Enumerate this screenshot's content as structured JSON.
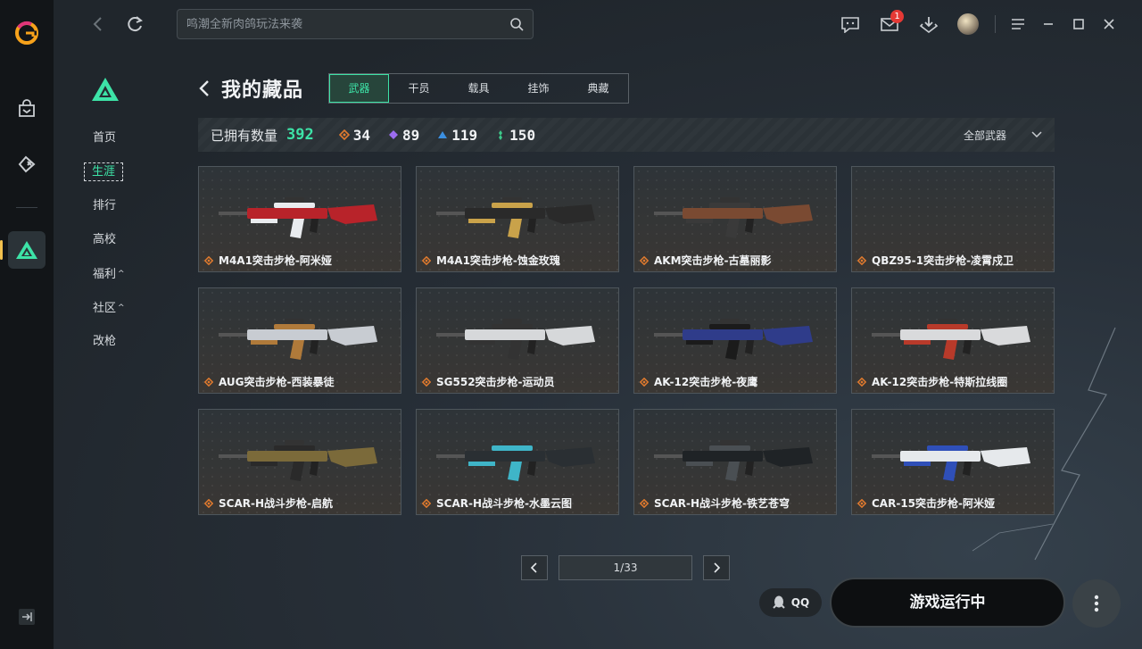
{
  "topbar": {
    "search_placeholder": "鸣潮全新肉鸽玩法来袭",
    "message_badge": "1"
  },
  "subnav": {
    "items": [
      {
        "label": "首页",
        "active": false,
        "caret": ""
      },
      {
        "label": "生涯",
        "active": true,
        "caret": ""
      },
      {
        "label": "排行",
        "active": false,
        "caret": ""
      },
      {
        "label": "高校",
        "active": false,
        "caret": ""
      },
      {
        "label": "福利",
        "active": false,
        "caret": "^"
      },
      {
        "label": "社区",
        "active": false,
        "caret": "^"
      },
      {
        "label": "改枪",
        "active": false,
        "caret": ""
      }
    ]
  },
  "page": {
    "title": "我的藏品",
    "tabs": [
      "武器",
      "干员",
      "载具",
      "挂饰",
      "典藏"
    ],
    "active_tab": 0
  },
  "stats": {
    "owned_label": "已拥有数量",
    "owned_total": "392",
    "rarities": [
      {
        "count": "34",
        "color": "#e07a2e"
      },
      {
        "count": "89",
        "color": "#9b6cf0"
      },
      {
        "count": "119",
        "color": "#3b8fe0"
      },
      {
        "count": "150",
        "color": "#3dc98a"
      }
    ],
    "filter_label": "全部武器"
  },
  "items": [
    {
      "name": "M4A1突击步枪-阿米娅",
      "rarity_color": "#e07a2e",
      "gun_color": "#b8232a",
      "accent": "#e9ecef"
    },
    {
      "name": "M4A1突击步枪-蚀金玫瑰",
      "rarity_color": "#e07a2e",
      "gun_color": "#2a2a2a",
      "accent": "#c9a24a"
    },
    {
      "name": "AKM突击步枪-古墓丽影",
      "rarity_color": "#e07a2e",
      "gun_color": "#7a4a32",
      "accent": "#3a3a3a"
    },
    {
      "name": "QBZ95-1突击步枪-凌霄戍卫",
      "rarity_color": "#e07a2e",
      "gun_color": "",
      "accent": ""
    },
    {
      "name": "AUG突击步枪-西装暴徒",
      "rarity_color": "#e07a2e",
      "gun_color": "#c8ccd2",
      "accent": "#b07a3a"
    },
    {
      "name": "SG552突击步枪-运动员",
      "rarity_color": "#e07a2e",
      "gun_color": "#d6d8da",
      "accent": "#333333"
    },
    {
      "name": "AK-12突击步枪-夜鹰",
      "rarity_color": "#e07a2e",
      "gun_color": "#2f3c8a",
      "accent": "#1b1b1b"
    },
    {
      "name": "AK-12突击步枪-特斯拉线圈",
      "rarity_color": "#e07a2e",
      "gun_color": "#d9dadc",
      "accent": "#b83a2a"
    },
    {
      "name": "SCAR-H战斗步枪-启航",
      "rarity_color": "#e07a2e",
      "gun_color": "#7b6a3a",
      "accent": "#2a2a2a"
    },
    {
      "name": "SCAR-H战斗步枪-水墨云图",
      "rarity_color": "#e07a2e",
      "gun_color": "#2a2f33",
      "accent": "#3fb5c8"
    },
    {
      "name": "SCAR-H战斗步枪-铁艺苍穹",
      "rarity_color": "#e07a2e",
      "gun_color": "#1f2326",
      "accent": "#4a4f53"
    },
    {
      "name": "CAR-15突击步枪-阿米娅",
      "rarity_color": "#e07a2e",
      "gun_color": "#e6e9ec",
      "accent": "#2f4fb8"
    }
  ],
  "pager": {
    "text": "1/33"
  },
  "bottom": {
    "qq_label": "QQ",
    "status_label": "游戏运行中"
  },
  "colors": {
    "accent": "#3de3a7",
    "active_tab_bg": "#27453b"
  }
}
